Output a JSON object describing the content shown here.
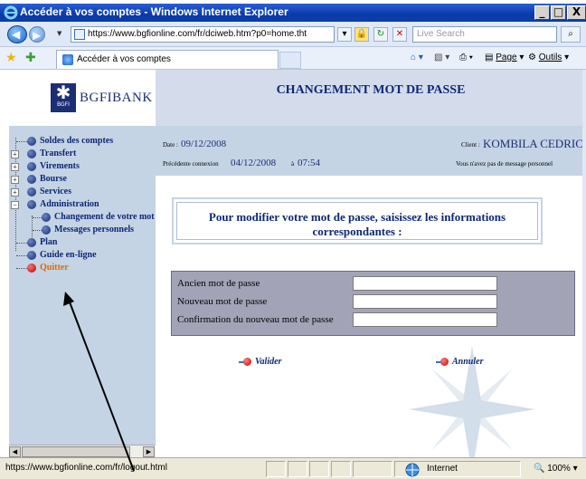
{
  "window": {
    "title": "Accéder à vos comptes - Windows Internet Explorer",
    "buttons": [
      "_",
      "□",
      "X"
    ]
  },
  "address": {
    "url": "https://www.bgfionline.com/fr/dciweb.htm?p0=home.tht",
    "search_placeholder": "Live Search"
  },
  "tabs": {
    "active_tab": "Accéder à vos comptes",
    "page_menu": "Page",
    "tools_menu": "Outils"
  },
  "header": {
    "logo_text": "BGFIBANK",
    "logo_small": "BGFI",
    "title": "CHANGEMENT MOT DE PASSE"
  },
  "sidebar": {
    "items": [
      {
        "label": "Soldes des comptes",
        "expandable": false
      },
      {
        "label": "Transfert",
        "expandable": true
      },
      {
        "label": "Virements",
        "expandable": true
      },
      {
        "label": "Bourse",
        "expandable": true
      },
      {
        "label": "Services",
        "expandable": true
      },
      {
        "label": "Administration",
        "expandable": true,
        "expanded": true
      },
      {
        "label": "Changement de votre mot",
        "child": true
      },
      {
        "label": "Messages personnels",
        "child": true
      },
      {
        "label": "Plan",
        "expandable": false
      },
      {
        "label": "Guide en-ligne",
        "expandable": false
      },
      {
        "label": "Quitter",
        "expandable": false,
        "highlight": true
      }
    ]
  },
  "info": {
    "date_label": "Date :",
    "date_value": "09/12/2008",
    "client_label": "Client :",
    "client_name": "KOMBILA CEDRIC",
    "previous_label": "Précédente connexion",
    "previous_date": "04/12/2008",
    "previous_at": "à",
    "previous_time": "07:54",
    "message_note": "Vous n'avez pas de message personnel"
  },
  "form": {
    "instruction": "Pour modifier votre mot de passe, saisissez les informations correspondantes :",
    "fields": [
      {
        "label": "Ancien mot de passe",
        "value": ""
      },
      {
        "label": "Nouveau mot de passe",
        "value": ""
      },
      {
        "label": "Confirmation du nouveau mot de passe",
        "value": ""
      }
    ],
    "validate_label": "Valider",
    "cancel_label": "Annuler"
  },
  "status": {
    "url": "https://www.bgfionline.com/fr/logout.html",
    "zone": "Internet",
    "zoom": "100%"
  },
  "colors": {
    "header_blue": "#0e2777",
    "sidebar_bg": "#c4d4e4",
    "form_bg": "#a3a3b8",
    "highlight_orange": "#e06b00"
  }
}
